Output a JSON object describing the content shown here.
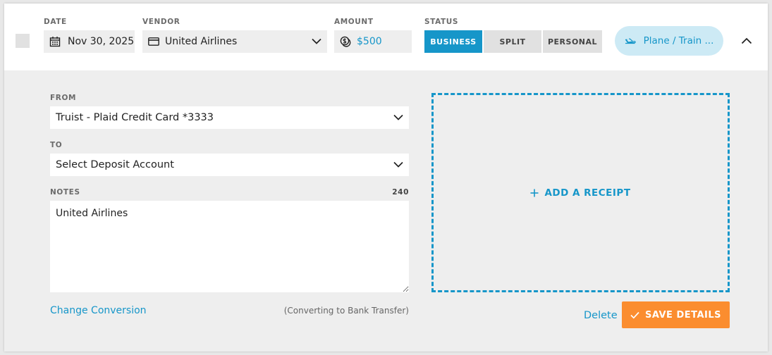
{
  "header": {
    "date": {
      "label": "DATE",
      "value": "Nov 30, 2025",
      "icon": "calendar-icon"
    },
    "vendor": {
      "label": "VENDOR",
      "value": "United Airlines",
      "icon": "credit-card-icon"
    },
    "amount": {
      "label": "AMOUNT",
      "value": "$500",
      "icon": "coins-icon"
    },
    "status": {
      "label": "STATUS",
      "options": [
        "BUSINESS",
        "SPLIT",
        "PERSONAL"
      ],
      "selected": "BUSINESS"
    },
    "category": {
      "label": "Plane / Train ...",
      "icon": "airplane-icon"
    }
  },
  "details": {
    "from": {
      "label": "FROM",
      "value": "Truist - Plaid Credit Card *3333"
    },
    "to": {
      "label": "TO",
      "value": "Select Deposit Account"
    },
    "notes": {
      "label": "NOTES",
      "count": "240",
      "value": "United Airlines"
    },
    "change_conversion": "Change Conversion",
    "conversion_note": "(Converting to Bank Transfer)"
  },
  "receipt": {
    "label": "ADD A RECEIPT"
  },
  "actions": {
    "delete": "Delete",
    "save": "SAVE DETAILS"
  },
  "colors": {
    "accent": "#1696c9",
    "save": "#fb8d2f",
    "pill_bg": "#cdeaf5",
    "panel_bg": "#eeeeee"
  }
}
